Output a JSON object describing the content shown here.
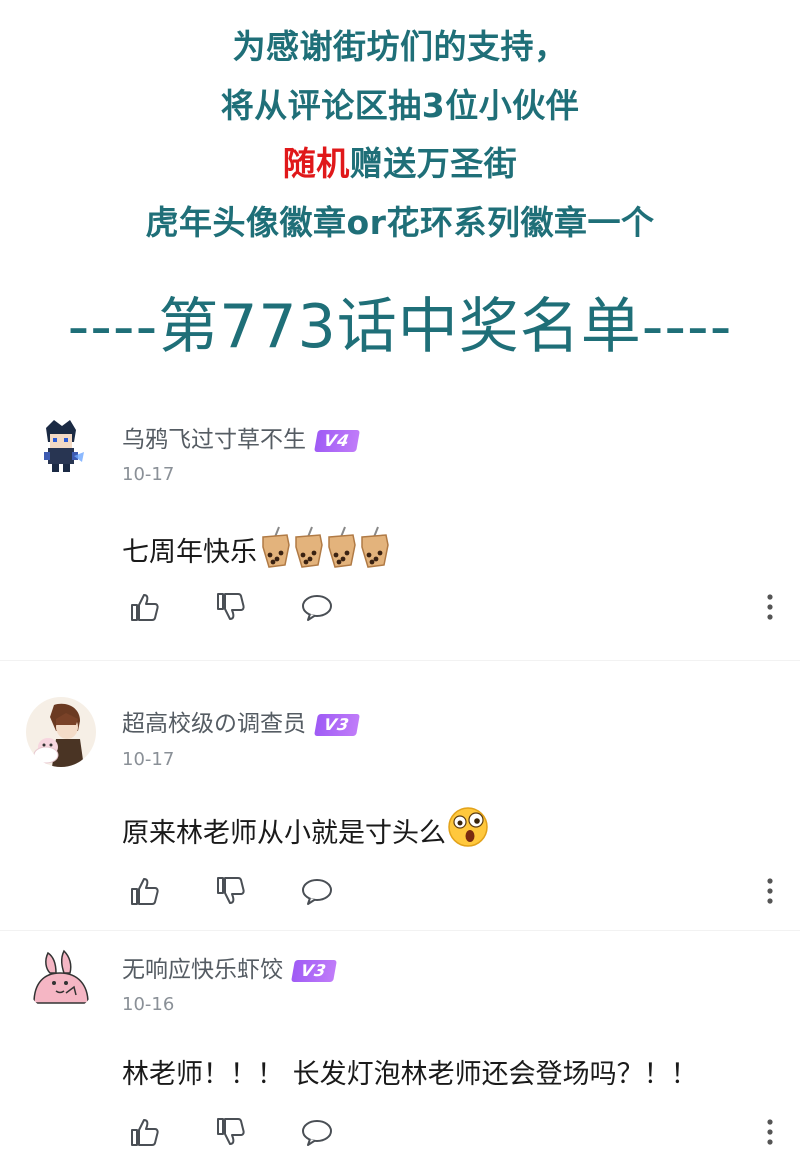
{
  "banner": {
    "line1": "为感谢街坊们的支持，",
    "line2": "将从评论区抽3位小伙伴",
    "line3_red": "随机",
    "line3_rest": "赠送万圣街",
    "line4": "虎年头像徽章or花环系列徽章一个",
    "title": "----第773话中奖名单----"
  },
  "colors": {
    "teal": "#1f6f78",
    "red": "#e0181a",
    "badge": "#a864f7"
  },
  "comments": [
    {
      "username": "乌鸦飞过寸草不生",
      "badge": "V4",
      "date": "10-17",
      "text": "七周年快乐",
      "emoji": "bubble-tea-icon ×4"
    },
    {
      "username": "超高校级の调查员",
      "badge": "V3",
      "date": "10-17",
      "text": "原来林老师从小就是寸头么",
      "emoji": "shocked-face-icon"
    },
    {
      "username": "无响应快乐虾饺",
      "badge": "V3",
      "date": "10-16",
      "text": "林老师！！！ 长发灯泡林老师还会登场吗？！！",
      "emoji": ""
    }
  ],
  "icons": {
    "like": "thumbs-up-icon",
    "dislike": "thumbs-down-icon",
    "reply": "speech-bubble-icon",
    "more": "more-vertical-icon"
  }
}
